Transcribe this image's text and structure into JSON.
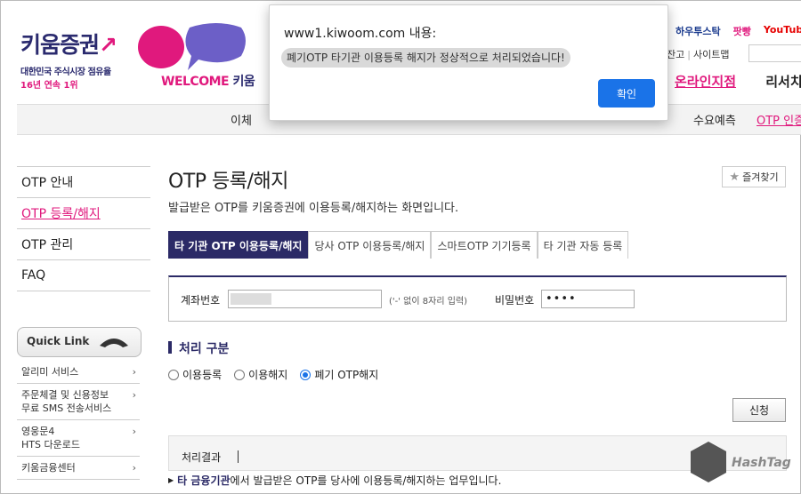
{
  "header": {
    "logo_text": "키움증권",
    "logo_sub1": "대한민국 주식시장 점유율",
    "logo_sub2": "16년 연속 1위",
    "welcome_pre": "WELCOME",
    "welcome_post": "키움",
    "top_links": [
      "하우투스탁",
      "팟빵",
      "YouTub"
    ],
    "util_links": [
      "잔고",
      "사이트맵"
    ],
    "main_nav": [
      "온라인지점",
      "리서치"
    ],
    "sub_nav": [
      "이체",
      "수요예측",
      "OTP 인증"
    ]
  },
  "sidebar": {
    "items": [
      "OTP 안내",
      "OTP 등록/해지",
      "OTP 관리",
      "FAQ"
    ],
    "active_index": 1,
    "quick_link_label": "Quick Link",
    "quick_items": [
      [
        "알리미 서비스"
      ],
      [
        "주문체결 및 신용정보",
        "무료 SMS 전송서비스"
      ],
      [
        "영웅문4",
        "HTS 다운로드"
      ],
      [
        "키움금융센터"
      ]
    ]
  },
  "main": {
    "title": "OTP 등록/해지",
    "favorite_label": "즐겨찾기",
    "description": "발급받은 OTP를 키움증권에 이용등록/해지하는 화면입니다.",
    "tabs": [
      "타 기관 OTP 이용등록/해지",
      "당사 OTP 이용등록/해지",
      "스마트OTP 기기등록",
      "타 기관 자동 등록"
    ],
    "active_tab": 0,
    "account_label": "계좌번호",
    "account_hint": "('-' 없이 8자리 입력)",
    "password_label": "비밀번호",
    "password_value": "••••",
    "section_title": "처리 구분",
    "options": [
      "이용등록",
      "이용해지",
      "폐기 OTP해지"
    ],
    "selected_option": 2,
    "apply_label": "신청",
    "result_label": "처리결과",
    "note_bold": "타 금융기관",
    "note_rest": "에서 발급받은 OTP를 당사에 이용등록/해지하는 업무입니다."
  },
  "watermark": "HashTag",
  "dialog": {
    "title": "www1.kiwoom.com 내용:",
    "message": "폐기OTP 타기관 이용등록 해지가 정상적으로 처리되었습니다!",
    "ok_label": "확인"
  }
}
